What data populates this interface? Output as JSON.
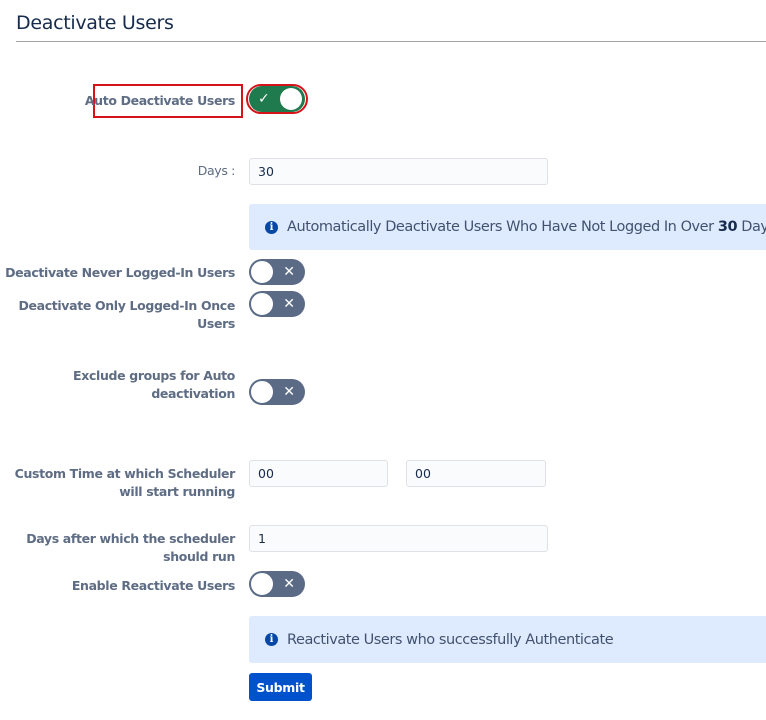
{
  "header": {
    "title": "Deactivate Users"
  },
  "form": {
    "auto_deactivate": {
      "label": "Auto Deactivate Users",
      "enabled": true,
      "glyph": "✓"
    },
    "days": {
      "label": "Days :",
      "value": "30"
    },
    "days_info": {
      "prefix": "Automatically Deactivate Users Who Have Not Logged In Over ",
      "days_bold": "30",
      "suffix": " Days"
    },
    "never_logged_in": {
      "label": "Deactivate Never Logged-In Users",
      "enabled": false,
      "glyph": "✕"
    },
    "logged_in_once": {
      "label_line1": "Deactivate Only Logged-In Once",
      "label_line2": "Users",
      "enabled": false,
      "glyph": "✕"
    },
    "exclude_groups": {
      "label_line1": "Exclude groups for Auto",
      "label_line2": "deactivation",
      "enabled": false,
      "glyph": "✕"
    },
    "custom_time": {
      "label_line1": "Custom Time at which Scheduler",
      "label_line2": "will start running",
      "hours": "00",
      "minutes": "00"
    },
    "scheduler_days": {
      "label_line1": "Days after which the scheduler",
      "label_line2": "should run",
      "value": "1"
    },
    "reactivate": {
      "label": "Enable Reactivate Users",
      "enabled": false,
      "glyph": "✕"
    },
    "reactivate_info": {
      "text": "Reactivate Users who successfully Authenticate"
    },
    "info_icon_glyph": "i",
    "submit_label": "Submit"
  },
  "colors": {
    "toggle_on": "#1f7a4d",
    "toggle_off": "#5b6b85",
    "info_bg": "#deebff",
    "primary": "#0052cc",
    "highlight": "#d7131a"
  }
}
